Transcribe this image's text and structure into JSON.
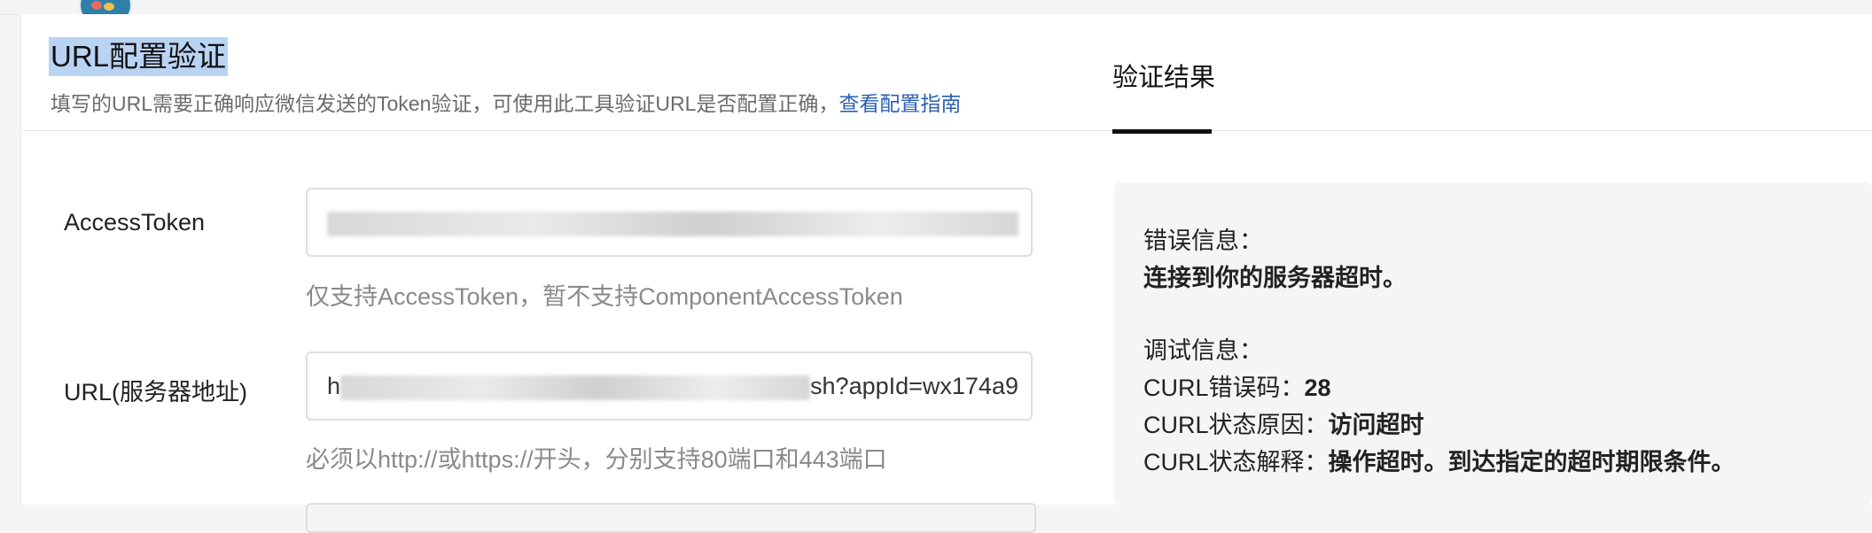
{
  "page": {
    "title": "URL配置验证",
    "description": "填写的URL需要正确响应微信发送的Token验证，可使用此工具验证URL是否配置正确，",
    "guide_link": "查看配置指南"
  },
  "form": {
    "fields": [
      {
        "label": "AccessToken",
        "value_visible_prefix": "",
        "hint": "仅支持AccessToken，暂不支持ComponentAccessToken"
      },
      {
        "label": "URL(服务器地址)",
        "value_visible_prefix": "h",
        "value_visible_mid": "sh?appId=wx174a9",
        "hint": "必须以http://或https://开头，分别支持80端口和443端口"
      }
    ]
  },
  "result": {
    "tab_label": "验证结果",
    "error_label": "错误信息：",
    "error_text": "连接到你的服务器超时。",
    "debug_label": "调试信息：",
    "curl_code_label": "CURL错误码：",
    "curl_code_value": "28",
    "curl_reason_label": "CURL状态原因：",
    "curl_reason_value": "访问超时",
    "curl_explain_label": "CURL状态解释：",
    "curl_explain_value": "操作超时。到达指定的超时期限条件。"
  },
  "colors": {
    "accent_link": "#2b5fb3",
    "title_highlight": "#b9d3f3"
  }
}
